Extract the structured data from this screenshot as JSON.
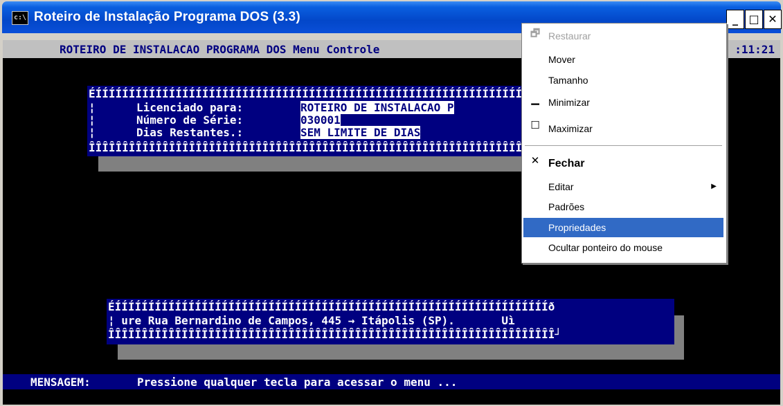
{
  "window": {
    "title": "Roteiro de Instalação Programa DOS (3.3)",
    "icon_text": "c:\\",
    "minimize_glyph": "_",
    "maximize_glyph": "□",
    "close_glyph": "✕"
  },
  "console": {
    "header": "ROTEIRO DE INSTALACAO PROGRAMA DOS Menu Controle",
    "clock": ":11:21",
    "license_box": {
      "top_border": "ÉÍÍÍÍÍÍÍÍÍÍÍÍÍÍÍÍÍÍÍÍÍÍÍÍÍÍÍÍÍÍÍÍÍÍÍÍÍÍÍÍÍÍÍÍÍÍÍÍÍÍÍÍÍÍÍÍÍÍÍÍÍÍÍÍÍÍÍ",
      "bottom_border": "ÎÎÎÎÎÎÎÎÎÎÎÎÎÎÎÎÎÎÎÎÎÎÎÎÎÎÎÎÎÎÎÎÎÎÎÎÎÎÎÎÎÎÎÎÎÎÎÎÎÎÎÎÎÎÎÎÎÎÎÎÎÎÎÎÎÎÎ",
      "side": "¦",
      "licensed_label": "Licenciado para:",
      "licensed_value": "ROTEIRO DE INSTALACAO P",
      "serial_label": "Número de Série:",
      "serial_value": "030001",
      "days_label": "Dias Restantes.:",
      "days_value": "SEM LIMITE DE DIAS"
    },
    "address_box": {
      "top_border": "ÉÍÍÍÍÍÍÍÍÍÍÍÍÍÍÍÍÍÍÍÍÍÍÍÍÍÍÍÍÍÍÍÍÍÍÍÍÍÍÍÍÍÍÍÍÍÍÍÍÍÍÍÍÍÍÍÍÍÍÍÍÍÍÍÍÍð",
      "content": "¦ ure Rua Bernardino de Campos, 445 → Itápolis (SP).       Uì",
      "bottom_border": "ÎÎÎÎÎÎÎÎÎÎÎÎÎÎÎÎÎÎÎÎÎÎÎÎÎÎÎÎÎÎÎÎÎÎÎÎÎÎÎÎÎÎÎÎÎÎÎÎÎÎÎÎÎÎÎÎÎÎÎÎÎÎÎÎÎÎÎ┘"
    },
    "message_label": "MENSAGEM:",
    "message_text": "Pressione qualquer tecla para acessar o menu ..."
  },
  "system_menu": {
    "items": [
      {
        "label": "Restaurar",
        "icon": "🗗",
        "state": "disabled"
      },
      {
        "label": "Mover",
        "icon": "",
        "state": "normal"
      },
      {
        "label": "Tamanho",
        "icon": "",
        "state": "normal"
      },
      {
        "label": "Minimizar",
        "icon": "▁",
        "state": "normal"
      },
      {
        "label": "Maximizar",
        "icon": "☐",
        "state": "normal"
      },
      {
        "label": "Fechar",
        "icon": "✕",
        "state": "bold"
      },
      {
        "label": "Editar",
        "icon": "",
        "state": "submenu",
        "arrow": "▶"
      },
      {
        "label": "Padrões",
        "icon": "",
        "state": "normal"
      },
      {
        "label": "Propriedades",
        "icon": "",
        "state": "highlighted"
      },
      {
        "label": "Ocultar ponteiro do mouse",
        "icon": "",
        "state": "normal"
      }
    ]
  },
  "colors": {
    "console_bg": "#000000",
    "dos_blue": "#000080",
    "menu_highlight": "#316ac5",
    "titlebar": "#0347c9"
  }
}
